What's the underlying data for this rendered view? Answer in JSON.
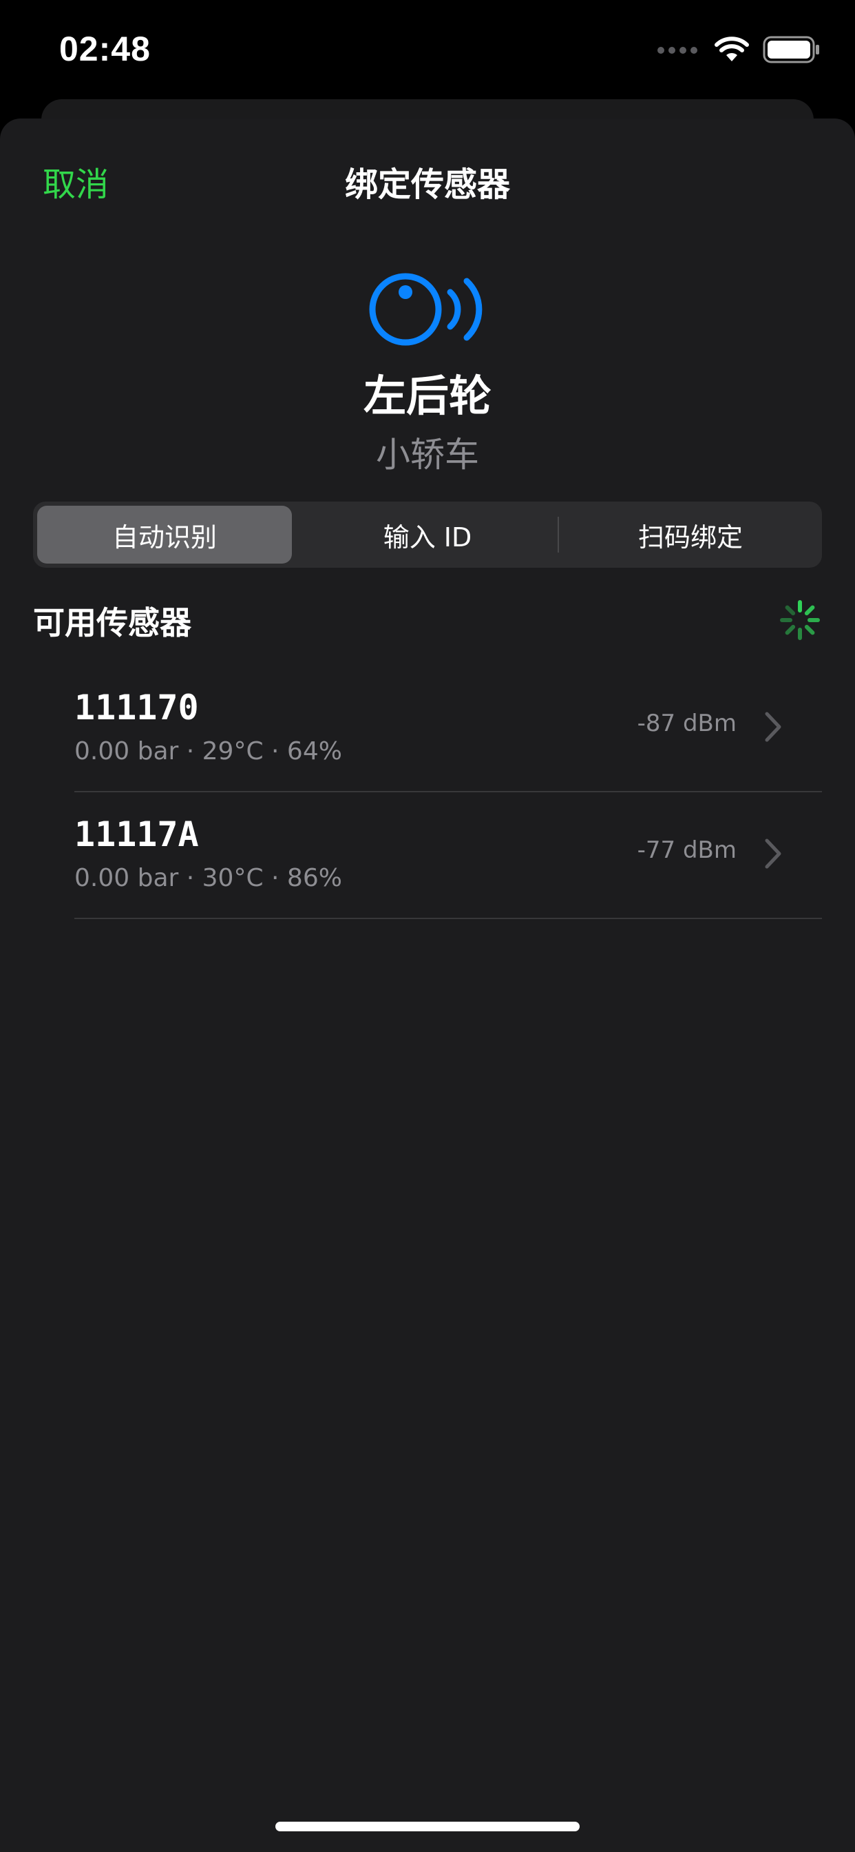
{
  "status_bar": {
    "time": "02:48",
    "icons": [
      "signal-icon",
      "wifi-icon",
      "battery-icon"
    ]
  },
  "nav": {
    "cancel_label": "取消",
    "title": "绑定传感器"
  },
  "header": {
    "icon": "tire-sensor-icon",
    "wheel": "左后轮",
    "vehicle_type": "小轿车"
  },
  "segments": {
    "items": [
      {
        "label": "自动识别",
        "selected": true
      },
      {
        "label": "输入 ID",
        "selected": false
      },
      {
        "label": "扫码绑定",
        "selected": false
      }
    ]
  },
  "section": {
    "title": "可用传感器",
    "loading_icon": "spinner-icon"
  },
  "sensors": [
    {
      "id": "111170",
      "detail": "0.00 bar · 29°C · 64%",
      "rssi": "-87 dBm"
    },
    {
      "id": "11117A",
      "detail": "0.00 bar · 30°C · 86%",
      "rssi": "-77 dBm"
    }
  ],
  "colors": {
    "accent_green": "#32d74b",
    "icon_blue": "#0a84ff",
    "background": "#1c1c1e",
    "secondary_text": "#8e8e93"
  }
}
